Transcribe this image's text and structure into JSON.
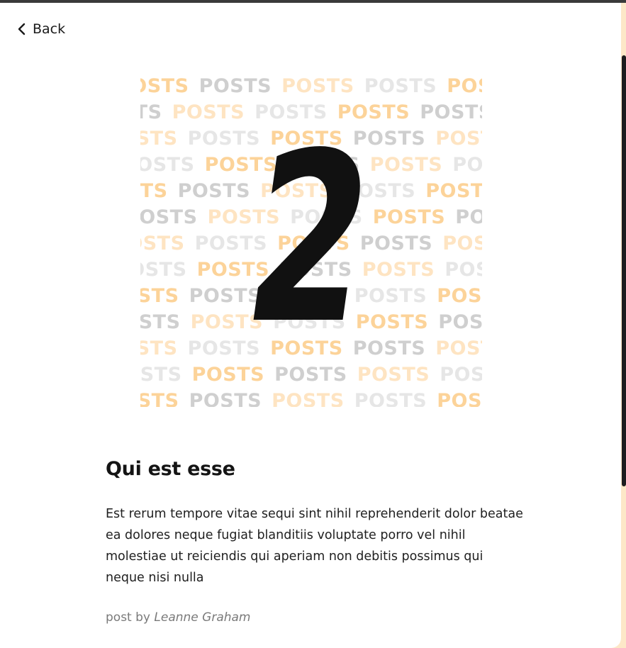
{
  "nav": {
    "back_label": "Back"
  },
  "cover": {
    "word": "POSTS",
    "number": "2"
  },
  "post": {
    "title": "Qui est esse",
    "body": "Est rerum tempore vitae sequi sint nihil reprehenderit dolor beatae ea dolores neque fugiat blanditiis voluptate porro vel nihil molestiae ut reiciendis qui aperiam non debitis possimus qui neque nisi nulla",
    "byline_prefix": "post by",
    "author": "Leanne Graham"
  },
  "colors": {
    "accent_light": "#fde8c8",
    "accent": "#fcd399",
    "text": "#141414"
  },
  "icons": {
    "back": "chevron-left-icon"
  }
}
